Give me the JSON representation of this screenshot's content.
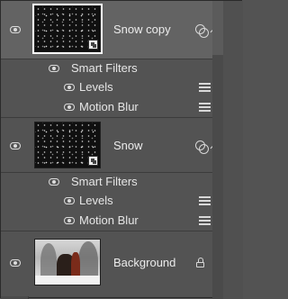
{
  "layers": [
    {
      "name": "Snow copy",
      "selected": true,
      "thumbnail": "snow-noise",
      "smart_filters_label": "Smart Filters",
      "filters": [
        "Levels",
        "Motion Blur"
      ]
    },
    {
      "name": "Snow",
      "selected": false,
      "thumbnail": "snow-noise",
      "smart_filters_label": "Smart Filters",
      "filters": [
        "Levels",
        "Motion Blur"
      ]
    },
    {
      "name": "Background",
      "selected": false,
      "thumbnail": "photo",
      "locked": true
    }
  ],
  "icons": {
    "visibility": "eye-icon",
    "linked": "linked-icon",
    "collapse": "chevron-up-icon",
    "filter_options": "filter-options-icon",
    "lock": "lock-icon",
    "smart_object_badge": "smart-object-icon"
  },
  "colors": {
    "panel_bg": "#535353",
    "selected_row": "#636363",
    "text": "#ececec",
    "divider": "#3c3c3c"
  }
}
